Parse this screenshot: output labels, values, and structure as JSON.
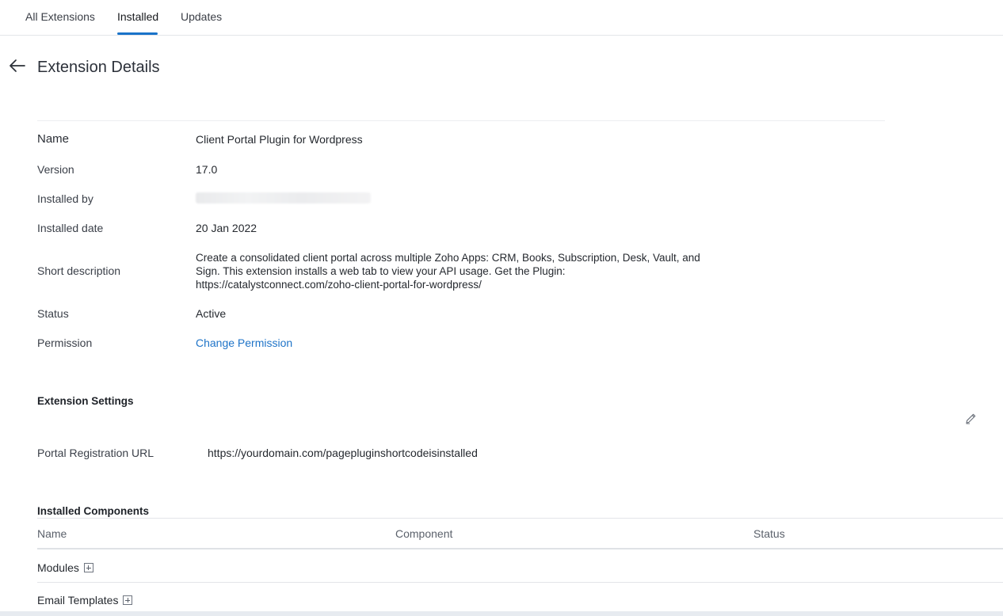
{
  "tabs": [
    {
      "label": "All Extensions",
      "active": false
    },
    {
      "label": "Installed",
      "active": true
    },
    {
      "label": "Updates",
      "active": false
    }
  ],
  "header": {
    "back_icon": "arrow-left-icon",
    "title": "Extension Details"
  },
  "details": {
    "name_label": "Name",
    "name_value": "Client Portal Plugin for Wordpress",
    "version_label": "Version",
    "version_value": "17.0",
    "installed_by_label": "Installed by",
    "installed_date_label": "Installed date",
    "installed_date_value": "20 Jan 2022",
    "short_description_label": "Short description",
    "short_description_value": "Create a consolidated client portal across multiple Zoho Apps: CRM, Books, Subscription, Desk, Vault, and Sign. This extension installs a web tab to view your API usage. Get the Plugin: https://catalystconnect.com/zoho-client-portal-for-wordpress/",
    "status_label": "Status",
    "status_value": "Active",
    "permission_label": "Permission",
    "permission_link": "Change Permission"
  },
  "settings": {
    "title": "Extension Settings",
    "edit_icon": "pencil-icon",
    "portal_url_label": "Portal Registration URL",
    "portal_url_value": "https://yourdomain.com/pagepluginshortcodeisinstalled"
  },
  "components": {
    "title": "Installed Components",
    "columns": [
      "Name",
      "Component",
      "Status"
    ],
    "rows": [
      {
        "label": "Modules",
        "expand_icon": "plus-square-icon"
      },
      {
        "label": "Email Templates",
        "expand_icon": "plus-square-icon"
      }
    ]
  },
  "colors": {
    "accent": "#1a73c9",
    "link": "#1f74c8"
  }
}
